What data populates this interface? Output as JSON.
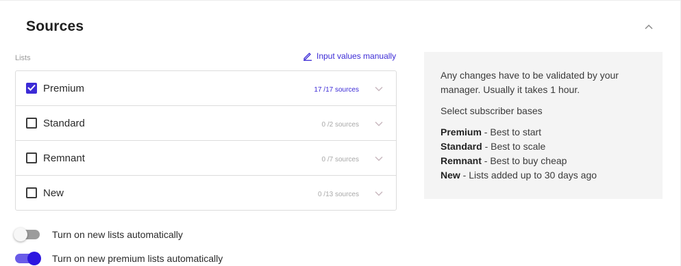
{
  "section": {
    "title": "Sources"
  },
  "lists": {
    "label": "Lists",
    "manual_link": "Input values manually",
    "items": [
      {
        "name": "Premium",
        "checked": true,
        "count": "17 /17  sources"
      },
      {
        "name": "Standard",
        "checked": false,
        "count": "0 /2 sources"
      },
      {
        "name": "Remnant",
        "checked": false,
        "count": "0 /7 sources"
      },
      {
        "name": "New",
        "checked": false,
        "count": "0 /13 sources"
      }
    ]
  },
  "info": {
    "note": "Any changes have to be validated by your manager. Usually it takes 1 hour.",
    "select_heading": "Select subscriber bases",
    "legend": [
      {
        "term": "Premium",
        "desc": " - Best to start"
      },
      {
        "term": "Standard",
        "desc": " - Best to scale"
      },
      {
        "term": "Remnant",
        "desc": " - Best to buy cheap"
      },
      {
        "term": "New",
        "desc": " - Lists added up to 30 days ago"
      }
    ]
  },
  "toggles": [
    {
      "label": "Turn on new lists automatically",
      "on": false
    },
    {
      "label": "Turn on new premium lists automatically",
      "on": true
    }
  ],
  "colors": {
    "accent": "#3c2bd6",
    "toggle_on_track": "#6a5ce8",
    "toggle_off_track": "#9c9c9c",
    "panel_bg": "#f4f4f4"
  },
  "icons": {
    "collapse": "chevron-up-icon",
    "manual": "pencil-icon",
    "row_expand": "chevron-down-icon",
    "check": "check-icon"
  }
}
